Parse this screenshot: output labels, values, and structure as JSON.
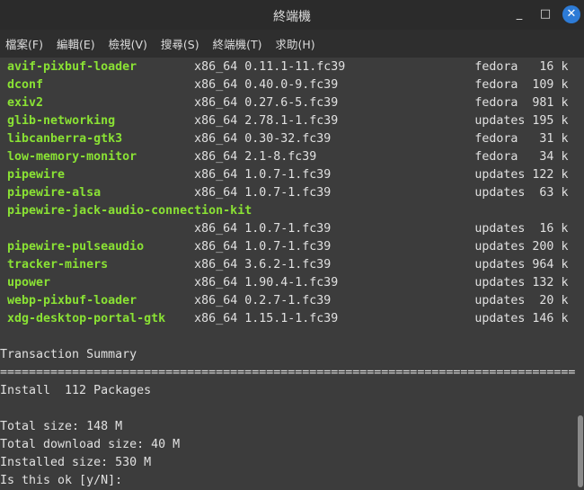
{
  "window": {
    "title": "終端機",
    "minimize": "_",
    "maximize": "□",
    "close": "✕"
  },
  "menu": [
    "檔案(F)",
    "編輯(E)",
    "檢視(V)",
    "搜尋(S)",
    "終端機(T)",
    "求助(H)"
  ],
  "packages": [
    {
      "name": "avif-pixbuf-loader",
      "arch": "x86_64",
      "version": "0.11.1-11.fc39",
      "repo": "fedora",
      "size": "16 k"
    },
    {
      "name": "dconf",
      "arch": "x86_64",
      "version": "0.40.0-9.fc39",
      "repo": "fedora",
      "size": "109 k"
    },
    {
      "name": "exiv2",
      "arch": "x86_64",
      "version": "0.27.6-5.fc39",
      "repo": "fedora",
      "size": "981 k"
    },
    {
      "name": "glib-networking",
      "arch": "x86_64",
      "version": "2.78.1-1.fc39",
      "repo": "updates",
      "size": "195 k"
    },
    {
      "name": "libcanberra-gtk3",
      "arch": "x86_64",
      "version": "0.30-32.fc39",
      "repo": "fedora",
      "size": "31 k"
    },
    {
      "name": "low-memory-monitor",
      "arch": "x86_64",
      "version": "2.1-8.fc39",
      "repo": "fedora",
      "size": "34 k"
    },
    {
      "name": "pipewire",
      "arch": "x86_64",
      "version": "1.0.7-1.fc39",
      "repo": "updates",
      "size": "122 k"
    },
    {
      "name": "pipewire-alsa",
      "arch": "x86_64",
      "version": "1.0.7-1.fc39",
      "repo": "updates",
      "size": "63 k"
    },
    {
      "name": "pipewire-jack-audio-connection-kit",
      "arch": "x86_64",
      "version": "1.0.7-1.fc39",
      "repo": "updates",
      "size": "16 k"
    },
    {
      "name": "pipewire-pulseaudio",
      "arch": "x86_64",
      "version": "1.0.7-1.fc39",
      "repo": "updates",
      "size": "200 k"
    },
    {
      "name": "tracker-miners",
      "arch": "x86_64",
      "version": "3.6.2-1.fc39",
      "repo": "updates",
      "size": "964 k"
    },
    {
      "name": "upower",
      "arch": "x86_64",
      "version": "1.90.4-1.fc39",
      "repo": "updates",
      "size": "132 k"
    },
    {
      "name": "webp-pixbuf-loader",
      "arch": "x86_64",
      "version": "0.2.7-1.fc39",
      "repo": "updates",
      "size": "20 k"
    },
    {
      "name": "xdg-desktop-portal-gtk",
      "arch": "x86_64",
      "version": "1.15.1-1.fc39",
      "repo": "updates",
      "size": "146 k"
    }
  ],
  "summary": {
    "heading": "Transaction Summary",
    "separator": "================================================================================",
    "install": "Install  112 Packages",
    "total_size": "Total size: 148 M",
    "download_size": "Total download size: 40 M",
    "installed_size": "Installed size: 530 M",
    "prompt": "Is this ok [y/N]: "
  }
}
